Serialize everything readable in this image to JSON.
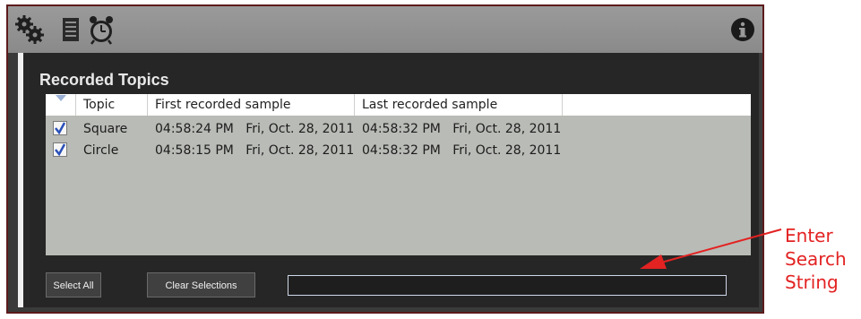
{
  "toolbar": {
    "icons": [
      "gears-icon",
      "document-icon",
      "alarm-clock-icon"
    ],
    "info_icon": "info-icon"
  },
  "panel": {
    "title": "Recorded Topics"
  },
  "table": {
    "columns": [
      "Topic",
      "First recorded sample",
      "Last recorded sample"
    ],
    "rows": [
      {
        "checked": true,
        "topic": "Square",
        "first": "04:58:24 PM   Fri, Oct. 28, 2011",
        "last": "04:58:32 PM   Fri, Oct. 28, 2011"
      },
      {
        "checked": true,
        "topic": "Circle",
        "first": "04:58:15 PM   Fri, Oct. 28, 2011",
        "last": "04:58:32 PM   Fri, Oct. 28, 2011"
      }
    ]
  },
  "buttons": {
    "select_all": "Select All",
    "clear_selections": "Clear Selections"
  },
  "search": {
    "value": ""
  },
  "annotation": {
    "lines": [
      "Enter",
      "Search",
      "String"
    ],
    "color": "#e32222"
  }
}
